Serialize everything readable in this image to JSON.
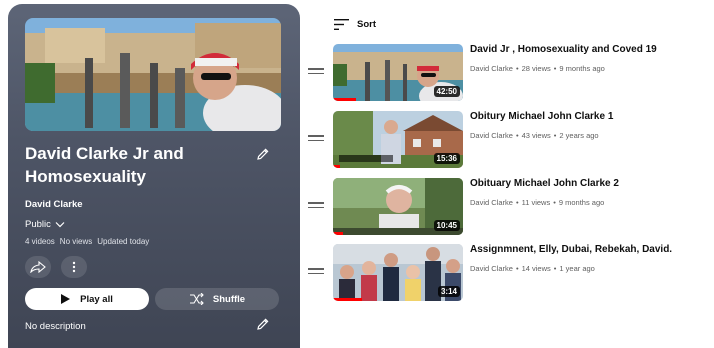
{
  "playlist": {
    "title_line1": "David Clarke Jr and",
    "title_line2": "Homosexuality",
    "owner": "David Clarke",
    "privacy": "Public",
    "video_count": "4 videos",
    "views": "No views",
    "updated": "Updated today",
    "play_all_label": "Play all",
    "shuffle_label": "Shuffle",
    "description": "No description",
    "icons": [
      "pencil-icon",
      "share-icon",
      "more-vert-icon",
      "play-icon",
      "shuffle-icon",
      "chevron-down-icon"
    ]
  },
  "sort_label": "Sort",
  "videos": [
    {
      "title": "David Jr , Homosexuality and Coved 19",
      "channel": "David Clarke",
      "views": "28 views",
      "age": "9 months ago",
      "duration": "42:50",
      "watched_fraction": 0.18
    },
    {
      "title": "Obitury Michael John Clarke 1",
      "channel": "David Clarke",
      "views": "43 views",
      "age": "2 years ago",
      "duration": "15:36",
      "watched_fraction": 0.05
    },
    {
      "title": "Obituary Michael John Clarke 2",
      "channel": "David Clarke",
      "views": "11 views",
      "age": "9 months ago",
      "duration": "10:45",
      "watched_fraction": 0.08
    },
    {
      "title": "Assignmnent, Elly, Dubai, Rebekah, David.",
      "channel": "David Clarke",
      "views": "14 views",
      "age": "1 year ago",
      "duration": "3:14",
      "watched_fraction": 0.22
    }
  ],
  "meta_separator": "•",
  "colors": {
    "panel": "#4e5566",
    "progress": "#ff0000",
    "text": "#0f0f0f",
    "secondary": "#606060"
  }
}
